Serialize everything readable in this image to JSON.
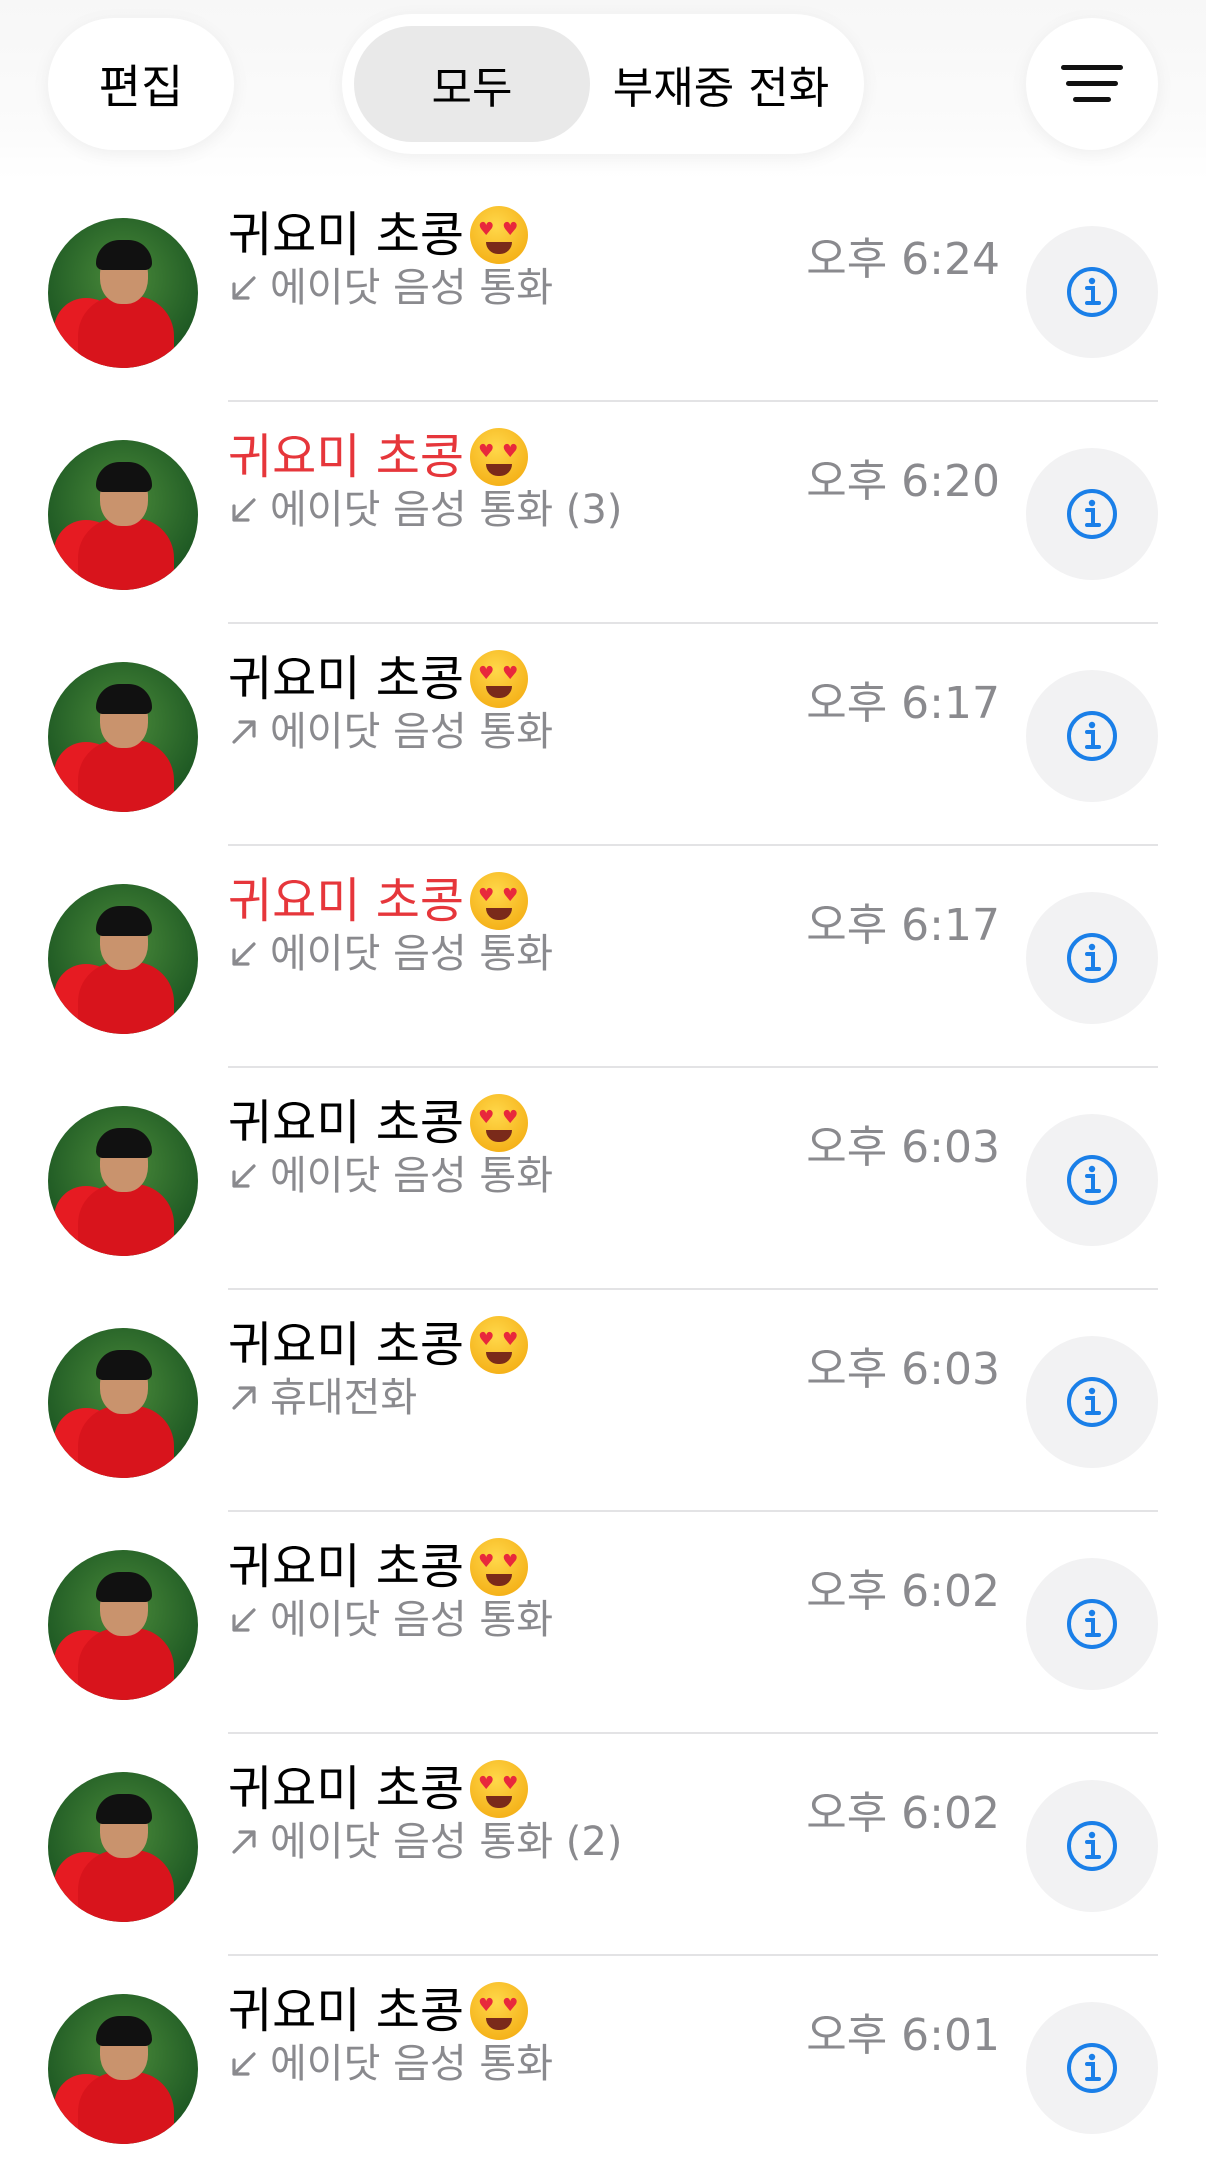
{
  "header": {
    "edit_label": "편집",
    "tabs": [
      {
        "label": "모두",
        "active": true
      },
      {
        "label": "부재중 전화",
        "active": false
      }
    ],
    "menu_icon": "filter-lines-icon"
  },
  "colors": {
    "missed": "#e6363b",
    "info_blue": "#1a7fe8",
    "secondary_text": "#8a8a8e"
  },
  "calls": [
    {
      "name": "귀요미 초콩",
      "missed": false,
      "direction": "incoming",
      "detail": "에이닷 음성 통화",
      "time": "오후 6:24"
    },
    {
      "name": "귀요미 초콩",
      "missed": true,
      "direction": "incoming",
      "detail": "에이닷 음성 통화 (3)",
      "time": "오후 6:20"
    },
    {
      "name": "귀요미 초콩",
      "missed": false,
      "direction": "outgoing",
      "detail": "에이닷 음성 통화",
      "time": "오후 6:17"
    },
    {
      "name": "귀요미 초콩",
      "missed": true,
      "direction": "incoming",
      "detail": "에이닷 음성 통화",
      "time": "오후 6:17"
    },
    {
      "name": "귀요미 초콩",
      "missed": false,
      "direction": "incoming",
      "detail": "에이닷 음성 통화",
      "time": "오후 6:03"
    },
    {
      "name": "귀요미 초콩",
      "missed": false,
      "direction": "outgoing",
      "detail": "휴대전화",
      "time": "오후 6:03"
    },
    {
      "name": "귀요미 초콩",
      "missed": false,
      "direction": "incoming",
      "detail": "에이닷 음성 통화",
      "time": "오후 6:02"
    },
    {
      "name": "귀요미 초콩",
      "missed": false,
      "direction": "outgoing",
      "detail": "에이닷 음성 통화 (2)",
      "time": "오후 6:02"
    },
    {
      "name": "귀요미 초콩",
      "missed": false,
      "direction": "incoming",
      "detail": "에이닷 음성 통화",
      "time": "오후 6:01"
    }
  ]
}
